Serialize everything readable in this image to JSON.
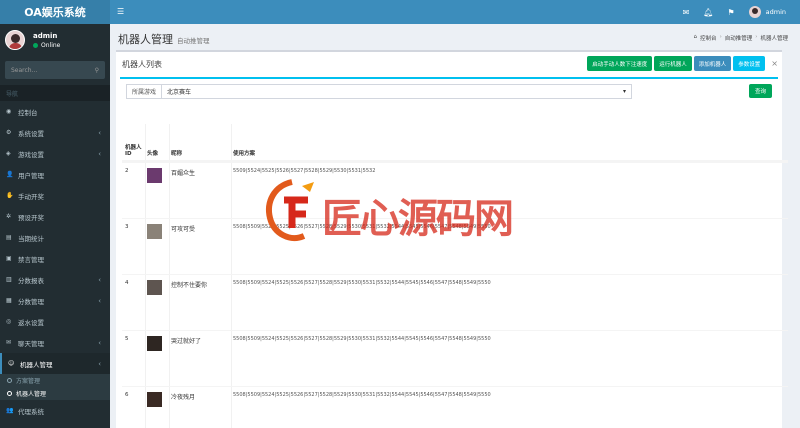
{
  "app": {
    "logo": "OA娱乐系统"
  },
  "user": {
    "name": "admin",
    "status": "Online"
  },
  "sidebar": {
    "search_placeholder": "Search...",
    "nav_header": "导航",
    "items": [
      {
        "label": "控制台",
        "icon": "dashboard-icon",
        "glyph": "◉",
        "has_children": false
      },
      {
        "label": "系统设置",
        "icon": "gear-icon",
        "glyph": "⚙",
        "has_children": true
      },
      {
        "label": "游戏设置",
        "icon": "gamepad-icon",
        "glyph": "◈",
        "has_children": true
      },
      {
        "label": "用户管理",
        "icon": "users-icon",
        "glyph": "👤",
        "has_children": false
      },
      {
        "label": "手动开奖",
        "icon": "hand-icon",
        "glyph": "✋",
        "has_children": false
      },
      {
        "label": "预设开奖",
        "icon": "settings-icon",
        "glyph": "✲",
        "has_children": false
      },
      {
        "label": "当期统计",
        "icon": "stats-icon",
        "glyph": "▤",
        "has_children": false
      },
      {
        "label": "禁言管理",
        "icon": "mute-icon",
        "glyph": "▣",
        "has_children": false
      },
      {
        "label": "分数报表",
        "icon": "report-icon",
        "glyph": "▥",
        "has_children": true
      },
      {
        "label": "分数管理",
        "icon": "score-icon",
        "glyph": "▦",
        "has_children": true
      },
      {
        "label": "返水设置",
        "icon": "refund-icon",
        "glyph": "◎",
        "has_children": false
      },
      {
        "label": "聊天管理",
        "icon": "chat-icon",
        "glyph": "✉",
        "has_children": true
      },
      {
        "label": "机器人管理",
        "icon": "robot-icon",
        "glyph": "☺",
        "has_children": true,
        "active": true
      }
    ],
    "submenu": [
      {
        "label": "方案管理"
      },
      {
        "label": "机器人管理"
      }
    ],
    "after": {
      "label": "代理系统",
      "icon": "agent-icon",
      "glyph": "👥"
    }
  },
  "topbar": {
    "user": "admin"
  },
  "header": {
    "title": "机器人管理",
    "subtitle": "自动推管理",
    "breadcrumbs": [
      "控制台",
      "自动推管理",
      "机器人管理"
    ]
  },
  "box": {
    "title": "机器人列表",
    "buttons": [
      {
        "label": "启动手动人数下注速度",
        "color": "green"
      },
      {
        "label": "运行机器人",
        "color": "green"
      },
      {
        "label": "添加机器人",
        "color": "blue"
      },
      {
        "label": "参数设置",
        "color": "cyan"
      }
    ],
    "filter": {
      "label": "所属游戏",
      "value": "北京赛车"
    },
    "query_button": "查询"
  },
  "table": {
    "headers": [
      "机器人ID",
      "头像",
      "昵称",
      "使用方案"
    ],
    "rows": [
      {
        "id": "2",
        "nickname": "百媚众生",
        "plan": "5509|5524|5525|5526|5527|5528|5529|5530|5531|5532"
      },
      {
        "id": "3",
        "nickname": "可攻可受",
        "plan": "5508|5509|5524|5525|5526|5527|5528|5529|5530|5531|5532|5544|5545|5546|5547|5548|5549|5550"
      },
      {
        "id": "4",
        "nickname": "控制不住要你",
        "plan": "5508|5509|5524|5525|5526|5527|5528|5529|5530|5531|5532|5544|5545|5546|5547|5548|5549|5550"
      },
      {
        "id": "5",
        "nickname": "哭过就好了",
        "plan": "5508|5509|5524|5525|5526|5527|5528|5529|5530|5531|5532|5544|5545|5546|5547|5548|5549|5550"
      },
      {
        "id": "6",
        "nickname": "冷夜残月",
        "plan": "5508|5509|5524|5525|5526|5527|5528|5529|5530|5531|5532|5544|5545|5546|5547|5548|5549|5550"
      }
    ]
  },
  "watermark": {
    "text": "匠心源码网"
  }
}
